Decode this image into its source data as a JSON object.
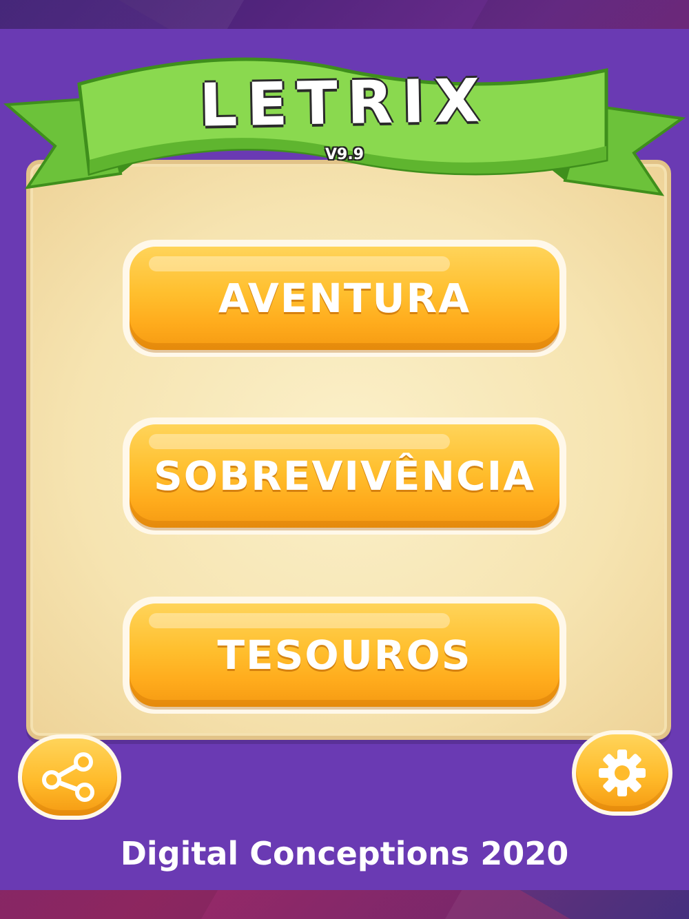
{
  "header": {
    "title": "LETRIX",
    "version": "V9.9"
  },
  "menu": {
    "buttons": [
      {
        "label": "AVENTURA"
      },
      {
        "label": "SOBREVIVÊNCIA"
      },
      {
        "label": "TESOUROS"
      }
    ]
  },
  "icons": {
    "share": "share-icon",
    "settings": "gear-icon"
  },
  "footer": {
    "credit": "Digital Conceptions 2020"
  },
  "colors": {
    "panel": "#6a3ab3",
    "ribbon": "#7fd34a",
    "button": "#ffbb2b",
    "parchment": "#f6e4b1"
  }
}
